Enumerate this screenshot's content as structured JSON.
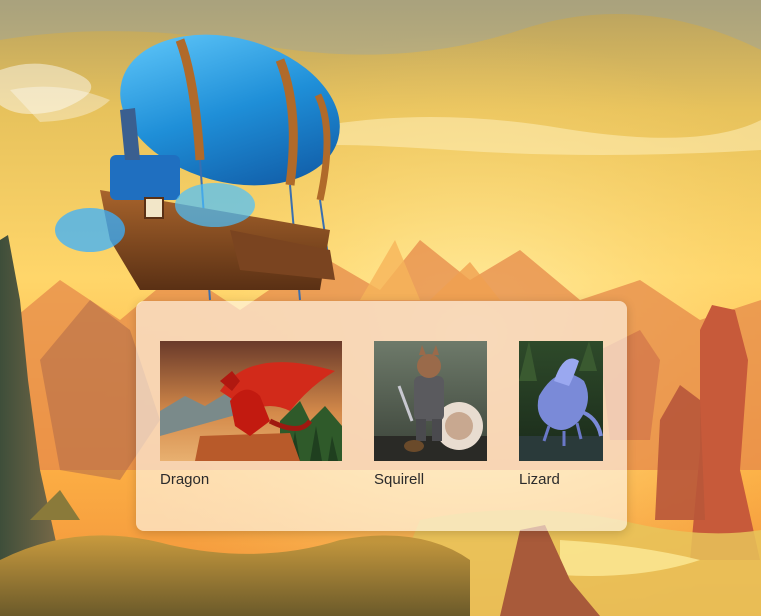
{
  "gallery": {
    "items": [
      {
        "label": "Dragon",
        "image": "red-dragon-on-rock"
      },
      {
        "label": "Squirell",
        "image": "armored-squirrel-knight"
      },
      {
        "label": "Lizard",
        "image": "blue-lizard-in-forest"
      }
    ]
  },
  "background": {
    "image": "airship-over-canyon-sunset"
  },
  "colors": {
    "sky_top": "#c9a64e",
    "sky_glow": "#ffd86b",
    "panel_bg": "#fffaf0",
    "label_text": "#2b2b2b",
    "airship_blue": "#2b9ee0",
    "airship_band": "#b06a2a"
  }
}
